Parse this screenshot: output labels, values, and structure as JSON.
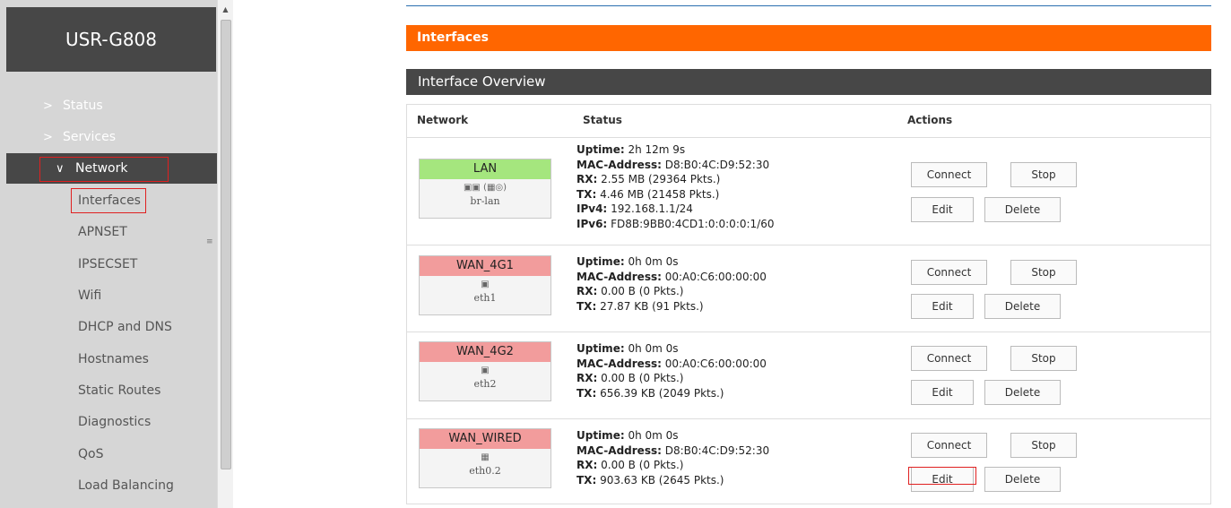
{
  "brand": "USR-G808",
  "menu": {
    "status": "Status",
    "services": "Services",
    "network": "Network",
    "chevron_right": ">",
    "chevron_down": "∨",
    "sub_items": [
      "Interfaces",
      "APNSET",
      "IPSECSET",
      "Wifi",
      "DHCP and DNS",
      "Hostnames",
      "Static Routes",
      "Diagnostics",
      "QoS",
      "Load Balancing"
    ]
  },
  "page": {
    "section_title": "Interfaces",
    "overview_title": "Interface Overview",
    "columns": {
      "network": "Network",
      "status": "Status",
      "actions": "Actions"
    }
  },
  "labels": {
    "uptime": "Uptime:",
    "mac": "MAC-Address:",
    "rx": "RX:",
    "tx": "TX:",
    "ipv4": "IPv4:",
    "ipv6": "IPv6:"
  },
  "buttons": {
    "connect": "Connect",
    "stop": "Stop",
    "edit": "Edit",
    "delete": "Delete"
  },
  "colors": {
    "up": "#a5e67e",
    "down": "#f29c9c",
    "accent": "#ff6600",
    "dark": "#474747"
  },
  "interfaces": [
    {
      "name": "LAN",
      "state": "up",
      "icon": "ethernet-bridge-icon",
      "device": "br-lan",
      "uptime": "2h 12m 9s",
      "mac": "D8:B0:4C:D9:52:30",
      "rx": "2.55 MB (29364 Pkts.)",
      "tx": "4.46 MB (21458 Pkts.)",
      "ipv4": "192.168.1.1/24",
      "ipv6": "FD8B:9BB0:4CD1:0:0:0:0:1/60"
    },
    {
      "name": "WAN_4G1",
      "state": "down",
      "icon": "ethernet-port-icon",
      "device": "eth1",
      "uptime": "0h 0m 0s",
      "mac": "00:A0:C6:00:00:00",
      "rx": "0.00 B (0 Pkts.)",
      "tx": "27.87 KB (91 Pkts.)"
    },
    {
      "name": "WAN_4G2",
      "state": "down",
      "icon": "ethernet-port-icon",
      "device": "eth2",
      "uptime": "0h 0m 0s",
      "mac": "00:A0:C6:00:00:00",
      "rx": "0.00 B (0 Pkts.)",
      "tx": "656.39 KB (2049 Pkts.)"
    },
    {
      "name": "WAN_WIRED",
      "state": "down",
      "icon": "switch-icon",
      "device": "eth0.2",
      "uptime": "0h 0m 0s",
      "mac": "D8:B0:4C:D9:52:30",
      "rx": "0.00 B (0 Pkts.)",
      "tx": "903.63 KB (2645 Pkts.)"
    }
  ]
}
